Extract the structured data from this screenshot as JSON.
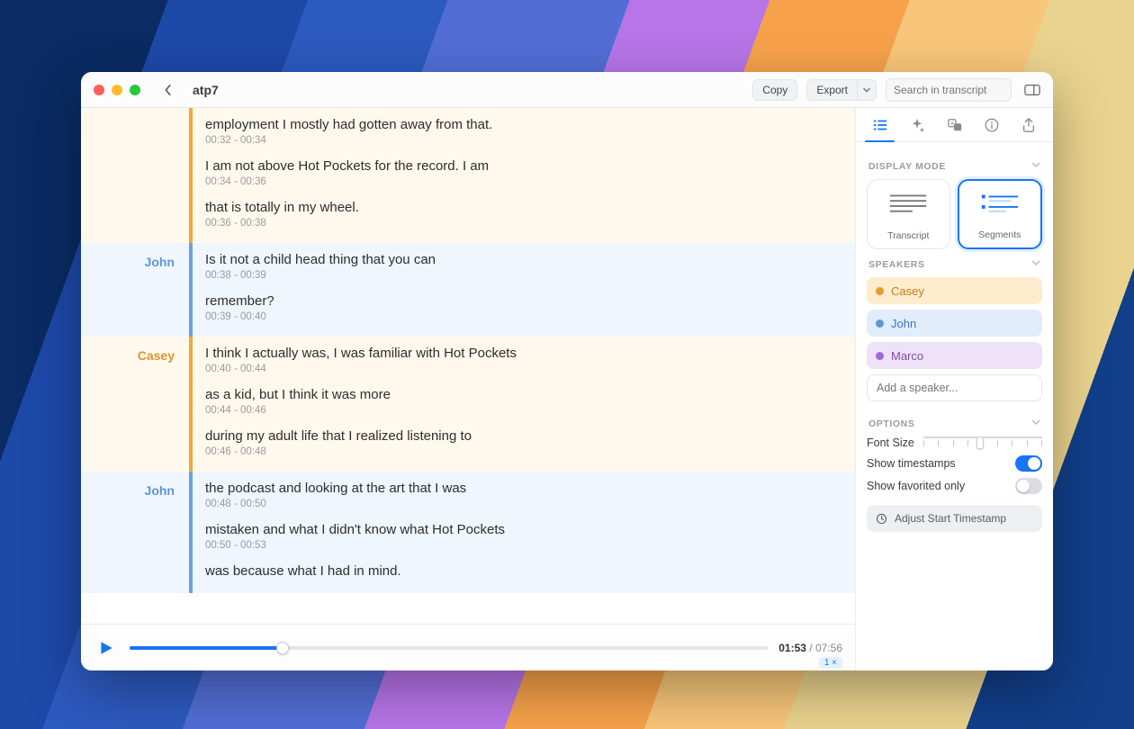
{
  "window": {
    "title": "atp7",
    "copy": "Copy",
    "export": "Export",
    "search_placeholder": "Search in transcript"
  },
  "player": {
    "current": "01:53",
    "total": "07:56",
    "rate": "1 ×",
    "progress_pct": 24
  },
  "sidebar": {
    "display_mode": {
      "header": "DISPLAY MODE",
      "transcript": "Transcript",
      "segments": "Segments"
    },
    "speakers": {
      "header": "SPEAKERS",
      "list": [
        {
          "name": "Casey",
          "class": "chip-casey"
        },
        {
          "name": "John",
          "class": "chip-john"
        },
        {
          "name": "Marco",
          "class": "chip-marco"
        }
      ],
      "add_placeholder": "Add a speaker..."
    },
    "options": {
      "header": "OPTIONS",
      "font_size": "Font Size",
      "show_ts": "Show timestamps",
      "show_fav": "Show favorited only",
      "adjust": "Adjust Start Timestamp"
    }
  },
  "segments": [
    {
      "speaker": "Casey",
      "class": "casey",
      "show_speaker": false,
      "lines": [
        {
          "text": "employment I mostly had gotten away from that.",
          "ts": "00:32 - 00:34"
        },
        {
          "text": "I am not above Hot Pockets for the record. I am",
          "ts": "00:34 - 00:36"
        },
        {
          "text": "that is totally in my wheel.",
          "ts": "00:36 - 00:38"
        }
      ]
    },
    {
      "speaker": "John",
      "class": "john",
      "show_speaker": true,
      "lines": [
        {
          "text": "Is it not a child head thing that you can",
          "ts": "00:38 - 00:39"
        },
        {
          "text": "remember?",
          "ts": "00:39 - 00:40"
        }
      ]
    },
    {
      "speaker": "Casey",
      "class": "casey",
      "show_speaker": true,
      "lines": [
        {
          "text": "I think I actually was, I was familiar with Hot Pockets",
          "ts": "00:40 - 00:44"
        },
        {
          "text": "as a kid, but I think it was more",
          "ts": "00:44 - 00:46"
        },
        {
          "text": "during my adult life that I realized listening to",
          "ts": "00:46 - 00:48"
        }
      ]
    },
    {
      "speaker": "John",
      "class": "john",
      "show_speaker": true,
      "lines": [
        {
          "text": "the podcast and looking at the art that I was",
          "ts": "00:48 - 00:50"
        },
        {
          "text": "mistaken and what I didn't know what Hot Pockets",
          "ts": "00:50 - 00:53"
        },
        {
          "text": "was because what I had in mind.",
          "ts": ""
        }
      ]
    }
  ]
}
